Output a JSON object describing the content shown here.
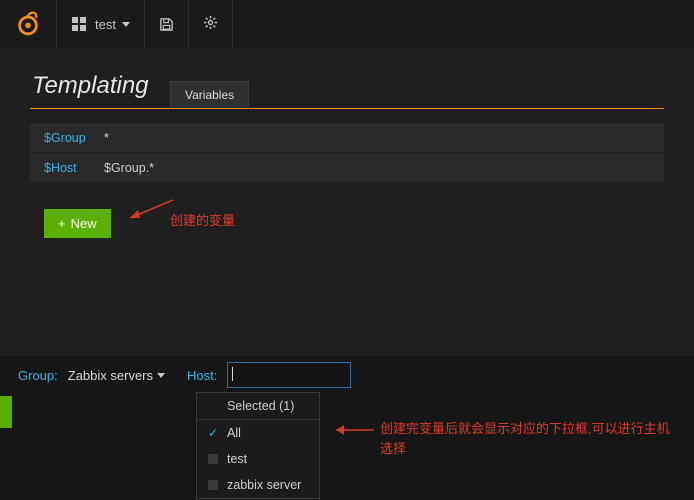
{
  "navbar": {
    "dashboard_label": "test"
  },
  "heading": "Templating",
  "tab_label": "Variables",
  "variables": [
    {
      "name": "$Group",
      "definition": "*"
    },
    {
      "name": "$Host",
      "definition": "$Group.*"
    }
  ],
  "new_button_label": "New",
  "annotations": {
    "created_vars": "创建的变量",
    "dropdown_explain": "创建完变量后就会显示对应的下拉框,可以进行主机选择"
  },
  "selectors": {
    "group_label": "Group:",
    "group_value": "Zabbix servers",
    "host_label": "Host:",
    "host_value": ""
  },
  "dropdown": {
    "header": "Selected (1)",
    "items": [
      {
        "label": "All",
        "checked": true
      },
      {
        "label": "test",
        "checked": false
      },
      {
        "label": "zabbix server",
        "checked": false
      }
    ]
  }
}
